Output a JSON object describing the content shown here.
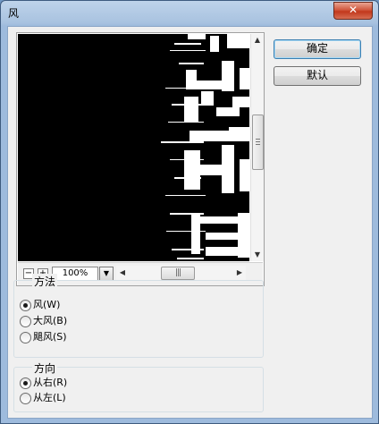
{
  "window": {
    "title": "风",
    "close_glyph": "✕"
  },
  "preview": {
    "zoom_value": "100%",
    "zoom_out_glyph": "−",
    "zoom_in_glyph": "+",
    "dropdown_glyph": "▼",
    "scroll_up_glyph": "▲",
    "scroll_down_glyph": "▼",
    "scroll_left_glyph": "◀",
    "scroll_right_glyph": "▶",
    "hthumb_grip": "|||"
  },
  "buttons": {
    "ok_label": "确定",
    "default_label": "默认"
  },
  "method_group": {
    "title": "方法",
    "options": [
      {
        "label": "风(W)",
        "checked": true
      },
      {
        "label": "大风(B)",
        "checked": false
      },
      {
        "label": "飓风(S)",
        "checked": false
      }
    ]
  },
  "direction_group": {
    "title": "方向",
    "options": [
      {
        "label": "从右(R)",
        "checked": true
      },
      {
        "label": "从左(L)",
        "checked": false
      }
    ]
  },
  "colors": {
    "close": "#c2381c",
    "preview_bg": "#000000",
    "default_border": "#3c7fb1"
  }
}
